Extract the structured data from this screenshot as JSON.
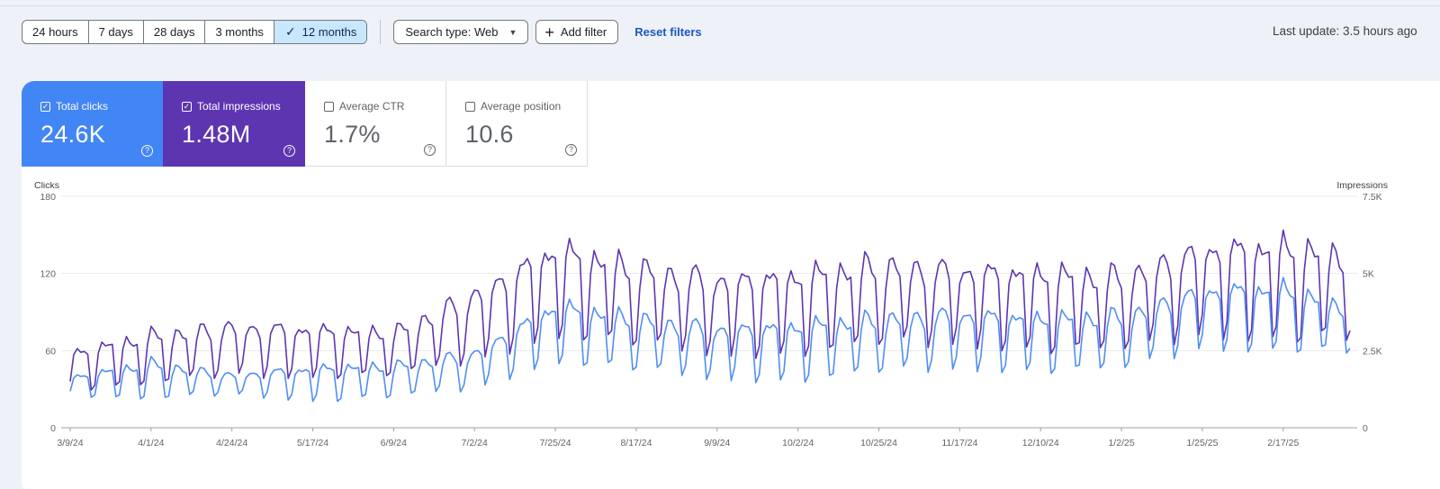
{
  "filters": {
    "ranges": [
      {
        "label": "24 hours",
        "active": false
      },
      {
        "label": "7 days",
        "active": false
      },
      {
        "label": "28 days",
        "active": false
      },
      {
        "label": "3 months",
        "active": false
      },
      {
        "label": "12 months",
        "active": true
      }
    ],
    "search_type": "Search type: Web",
    "add_filter": "Add filter",
    "reset": "Reset filters"
  },
  "last_update": "Last update: 3.5 hours ago",
  "metrics": [
    {
      "label": "Total clicks",
      "value": "24.6K",
      "checked": true,
      "color": "#4285f4"
    },
    {
      "label": "Total impressions",
      "value": "1.48M",
      "checked": true,
      "color": "#5e35b1"
    },
    {
      "label": "Average CTR",
      "value": "1.7%",
      "checked": false
    },
    {
      "label": "Average position",
      "value": "10.6",
      "checked": false
    }
  ],
  "chart_data": {
    "type": "line",
    "ylabel_left": "Clicks",
    "ylabel_right": "Impressions",
    "left_ticks": [
      "0",
      "60",
      "120",
      "180"
    ],
    "left_range": [
      0,
      180
    ],
    "right_ticks": [
      "0",
      "2.5K",
      "5K",
      "7.5K"
    ],
    "right_range": [
      0,
      7500
    ],
    "x_tick_labels": [
      "3/9/24",
      "4/1/24",
      "4/24/24",
      "5/17/24",
      "6/9/24",
      "7/2/24",
      "7/25/24",
      "8/17/24",
      "9/9/24",
      "10/2/24",
      "10/25/24",
      "11/17/24",
      "12/10/24",
      "1/2/25",
      "1/25/25",
      "2/17/25"
    ],
    "x_start": "3/9/24",
    "x_end": "3/8/25",
    "grid": true,
    "series": [
      {
        "name": "Total clicks",
        "axis": "left",
        "color": "#4f8ef5",
        "weekly_anchor_dates": [
          "3/9/24",
          "4/1/24",
          "4/24/24",
          "5/17/24",
          "6/9/24",
          "7/2/24",
          "7/25/24",
          "8/17/24",
          "9/9/24",
          "10/2/24",
          "10/25/24",
          "11/17/24",
          "12/10/24",
          "1/2/25",
          "1/25/25",
          "2/17/25",
          "3/8/25"
        ],
        "weekday_highs": [
          40,
          52,
          42,
          48,
          50,
          60,
          98,
          88,
          80,
          82,
          88,
          92,
          88,
          90,
          110,
          112,
          95
        ],
        "weekend_lows": [
          25,
          20,
          25,
          20,
          22,
          28,
          50,
          42,
          35,
          35,
          40,
          44,
          42,
          42,
          60,
          58,
          55
        ]
      },
      {
        "name": "Total impressions",
        "axis": "right",
        "color": "#5e35b1",
        "weekly_anchor_dates": [
          "3/9/24",
          "4/1/24",
          "4/24/24",
          "5/17/24",
          "6/9/24",
          "7/2/24",
          "7/25/24",
          "8/17/24",
          "9/9/24",
          "10/2/24",
          "10/25/24",
          "11/17/24",
          "12/10/24",
          "1/2/25",
          "1/25/25",
          "2/17/25",
          "3/8/25"
        ],
        "weekday_highs": [
          2500,
          3100,
          3400,
          3300,
          3200,
          4500,
          6000,
          5400,
          5000,
          5100,
          5500,
          5300,
          5200,
          5100,
          6000,
          6100,
          5800
        ],
        "weekend_lows": [
          1200,
          1300,
          1600,
          1600,
          1600,
          2000,
          2900,
          2500,
          2200,
          2300,
          2500,
          2600,
          2400,
          2300,
          2900,
          2700,
          2600
        ]
      }
    ]
  }
}
